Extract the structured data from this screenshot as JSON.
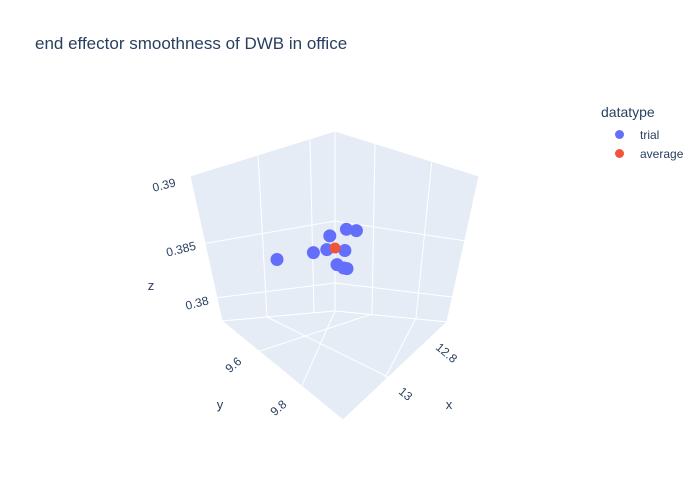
{
  "chart_data": {
    "type": "scatter3d",
    "title": "end effector smoothness of DWB in office",
    "legend_title": "datatype",
    "legend_position": "top-right",
    "axes": {
      "x": {
        "label": "x",
        "ticks": [
          "12.8",
          "13"
        ]
      },
      "y": {
        "label": "y",
        "ticks": [
          "9.6",
          "9.8"
        ]
      },
      "z": {
        "label": "z",
        "ticks": [
          "0.38",
          "0.385",
          "0.39"
        ]
      }
    },
    "series": [
      {
        "name": "trial",
        "color": "#636efa",
        "points": [
          {
            "x": 12.62,
            "y": 9.8,
            "z": 0.3842
          },
          {
            "x": 12.74,
            "y": 9.7,
            "z": 0.3847
          },
          {
            "x": 12.85,
            "y": 9.62,
            "z": 0.3848
          },
          {
            "x": 12.78,
            "y": 9.64,
            "z": 0.3862
          },
          {
            "x": 12.88,
            "y": 9.58,
            "z": 0.3868
          },
          {
            "x": 12.84,
            "y": 9.6,
            "z": 0.3869
          },
          {
            "x": 12.8,
            "y": 9.68,
            "z": 0.3852
          },
          {
            "x": 12.86,
            "y": 9.68,
            "z": 0.3839
          },
          {
            "x": 12.89,
            "y": 9.67,
            "z": 0.3836
          },
          {
            "x": 12.9,
            "y": 9.66,
            "z": 0.3835
          }
        ]
      },
      {
        "name": "average",
        "color": "#ef553b",
        "points": [
          {
            "x": 12.82,
            "y": 9.65,
            "z": 0.3852
          }
        ]
      }
    ]
  }
}
